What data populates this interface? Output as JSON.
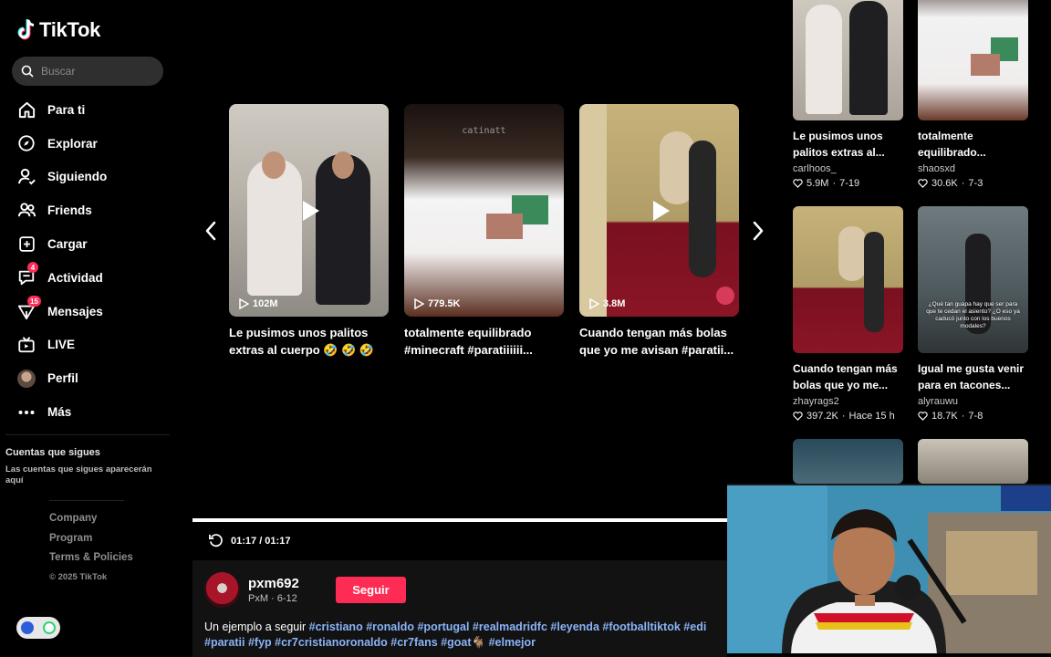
{
  "app": {
    "name": "TikTok"
  },
  "search": {
    "placeholder": "Buscar"
  },
  "nav": [
    {
      "label": "Para ti",
      "icon": "home-icon"
    },
    {
      "label": "Explorar",
      "icon": "compass-icon"
    },
    {
      "label": "Siguiendo",
      "icon": "following-icon"
    },
    {
      "label": "Friends",
      "icon": "friends-icon"
    },
    {
      "label": "Cargar",
      "icon": "upload-icon"
    },
    {
      "label": "Actividad",
      "icon": "activity-icon",
      "badge": "4"
    },
    {
      "label": "Mensajes",
      "icon": "messages-icon",
      "badge": "15"
    },
    {
      "label": "LIVE",
      "icon": "live-icon"
    },
    {
      "label": "Perfil",
      "icon": "avatar"
    },
    {
      "label": "Más",
      "icon": "more-icon"
    }
  ],
  "following": {
    "title": "Cuentas que sigues",
    "subtitle": "Las cuentas que sigues aparecerán aquí"
  },
  "footer": {
    "links": [
      "Company",
      "Program",
      "Terms & Policies"
    ],
    "copyright": "© 2025 TikTok"
  },
  "carousel": [
    {
      "views": "102M",
      "caption": "Le pusimos unos palitos extras al cuerpo 🤣 🤣 🤣 y..."
    },
    {
      "views": "779.5K",
      "caption": "totalmente equilibrado #minecraft #paratiiiiii..."
    },
    {
      "views": "3.8M",
      "caption": "Cuando tengan más bolas que yo me avisan #paratii..."
    }
  ],
  "grid": [
    {
      "caption": "Le pusimos unos palitos extras al...",
      "author": "carlhoos_",
      "likes": "5.9M",
      "date": "7-19"
    },
    {
      "caption": "totalmente equilibrado...",
      "author": "shaosxd",
      "likes": "30.6K",
      "date": "7-3"
    },
    {
      "caption": "Cuando tengan más bolas que yo me...",
      "author": "zhayrags2",
      "likes": "397.2K",
      "date": "Hace 15 h"
    },
    {
      "caption": "Igual me gusta venir para en tacones...",
      "author": "alyrauwu",
      "likes": "18.7K",
      "date": "7-8"
    }
  ],
  "thumb_overlay_text": {
    "minecraft": "catinatt",
    "subway": "¿Qué tan guapa hay que ser para que te cedan el asiento? ¿O eso ya caducó junto con los buenos modales?"
  },
  "player": {
    "time": "01:17 / 01:17",
    "progress": 1.0,
    "author_name": "pxm692",
    "author_sub": "PxM · 6-12",
    "follow_label": "Seguir",
    "description_text": "Un ejemplo a seguir",
    "hashtags_line1": [
      "#cristiano",
      "#ronaldo",
      "#portugal",
      "#realmadridfc",
      "#leyenda",
      "#footballtiktok",
      "#edi"
    ],
    "hashtags_line2": [
      "#paratii",
      "#fyp",
      "#cr7cristianoronaldo",
      "#cr7fans",
      "#goat🐐",
      "#elmejor"
    ]
  },
  "colors": {
    "accent": "#fe2c55",
    "link": "#8ab4f8",
    "background": "#000000"
  }
}
